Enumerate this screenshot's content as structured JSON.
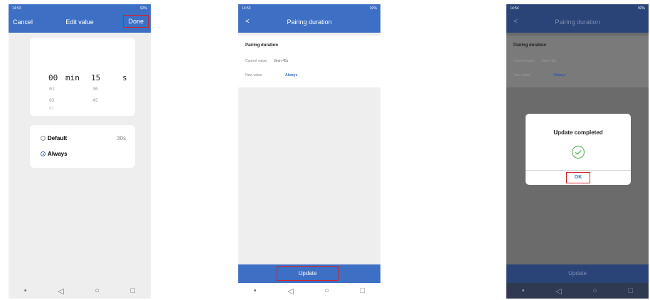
{
  "screens": [
    {
      "status_time": "14:53",
      "status_right": "92%",
      "appbar": {
        "cancel": "Cancel",
        "title": "Edit value",
        "done": "Done"
      },
      "picker": {
        "minutes_selected": "00",
        "min_unit": "min",
        "seconds_selected": "15",
        "sec_unit": "s",
        "minutes_below": [
          "01",
          "02",
          "03"
        ],
        "seconds_below": [
          "30",
          "45"
        ]
      },
      "options": [
        {
          "label": "Default",
          "value": "30s",
          "selected": false
        },
        {
          "label": "Always",
          "value": "",
          "selected": true
        }
      ]
    },
    {
      "status_time": "14:53",
      "status_right": "92%",
      "appbar": {
        "back": "<",
        "title": "Pairing duration"
      },
      "section_title": "Pairing duration",
      "current_label": "Current value",
      "current_value": "0min 45s",
      "new_label": "New value",
      "new_value": "Always",
      "update_button": "Update"
    },
    {
      "status_time": "14:54",
      "status_right": "92%",
      "appbar": {
        "back": "<",
        "title": "Pairing duration"
      },
      "section_title": "Pairing duration",
      "current_label": "Current value",
      "current_value": "0min 45s",
      "new_label": "New value",
      "new_value": "Always",
      "update_button": "Update",
      "dialog": {
        "title": "Update completed",
        "ok": "OK"
      }
    }
  ],
  "nav_icons": [
    "recent-dot",
    "back-triangle",
    "home-circle",
    "overview-square"
  ],
  "colors": {
    "accent": "#3d6fc4",
    "highlight": "#d2232a",
    "success": "#5cb85c"
  }
}
